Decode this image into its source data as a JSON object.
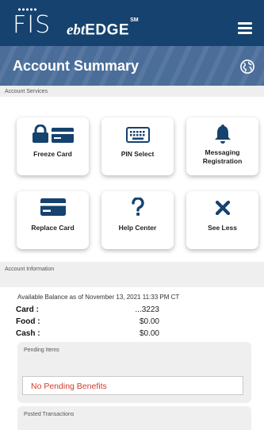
{
  "header": {
    "logo_text": "FIS",
    "brand_prefix": "ebt",
    "brand_name": "EDGE",
    "brand_mark": "SM",
    "menu_icon": "hamburger-menu-icon",
    "background_color": "#15426e"
  },
  "title_bar": {
    "title": "Account Summary",
    "globe_icon": "globe-icon",
    "background_color": "#4a6d99"
  },
  "services": {
    "section_label": "Account Services",
    "tiles": [
      {
        "label": "Freeze Card",
        "icon": "lock-card-icon"
      },
      {
        "label": "PIN Select",
        "icon": "keyboard-icon"
      },
      {
        "label": "Messaging Registration",
        "icon": "bell-icon"
      },
      {
        "label": "Replace Card",
        "icon": "card-icon"
      },
      {
        "label": "Help Center",
        "icon": "question-icon"
      },
      {
        "label": "See Less",
        "icon": "close-icon"
      }
    ]
  },
  "account_info": {
    "section_label": "Account Information",
    "balance_caption": "Available Balance as of November 13, 2021 11:33 PM CT",
    "rows": [
      {
        "key": "Card :",
        "value": "...3223"
      },
      {
        "key": "Food :",
        "value": "$0.00"
      },
      {
        "key": "Cash :",
        "value": "$0.00"
      }
    ]
  },
  "pending": {
    "title": "Pending Items",
    "message": "No Pending Benefits",
    "message_color": "#d13a2b"
  },
  "posted": {
    "title": "Posted Transactions"
  }
}
